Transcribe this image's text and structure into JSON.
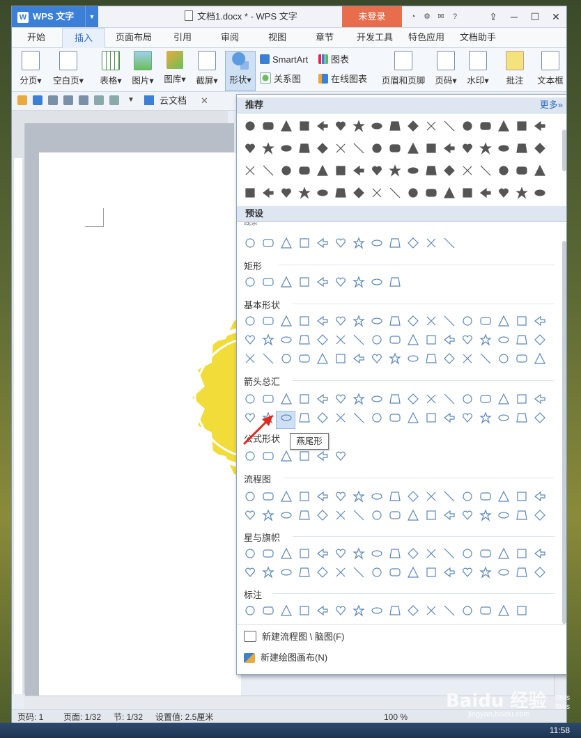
{
  "app": {
    "name": "WPS 文字",
    "doc_title": "文档1.docx * - WPS 文字",
    "login": "未登录"
  },
  "tabs": [
    "开始",
    "插入",
    "页面布局",
    "引用",
    "审阅",
    "视图",
    "章节",
    "开发工具",
    "特色应用",
    "文档助手"
  ],
  "ribbon": {
    "page_break": "分页",
    "blank_page": "空白页",
    "table": "表格",
    "picture": "图片",
    "gallery": "图库",
    "screenshot": "截屏",
    "shapes": "形状",
    "smartart": "SmartArt",
    "chart": "图表",
    "relation_chart": "关系图",
    "online_chart": "在线图表",
    "header_footer": "页眉和页脚",
    "page_number": "页码",
    "watermark": "水印",
    "comment": "批注",
    "textbox": "文本框"
  },
  "qat": {
    "cloud_doc": "云文档"
  },
  "panel": {
    "recommended": "推荐",
    "more": "更多»",
    "preset": "预设",
    "categories": {
      "lines_partial": "线条",
      "rect": "矩形",
      "basic": "基本形状",
      "arrows": "箭头总汇",
      "formula": "公式形状",
      "flowchart": "流程图",
      "stars": "星与旗帜",
      "callouts": "标注"
    },
    "tooltip": "燕尾形",
    "new_flowchart": "新建流程图 \\ 脑图(F)",
    "new_canvas": "新建绘图画布(N)"
  },
  "status": {
    "page_code": "页码: 1",
    "pages": "页面: 1/32",
    "section": "节: 1/32",
    "setting": "设置值: 2.5厘米",
    "zoom": "100 %"
  },
  "taskbar": {
    "clock": "11:58"
  },
  "watermark": {
    "brand": "Baidu 经验",
    "site": "jingyan.baidu.com"
  },
  "net": {
    "up": "0K/s",
    "down": "0K/s"
  },
  "colors": {
    "accent": "#3b7fd6",
    "login_bg": "#e86d4d",
    "shape_stroke": "#5b87b6",
    "recommended_fill": "#555555",
    "sun_yellow": "#f2dc3a"
  }
}
